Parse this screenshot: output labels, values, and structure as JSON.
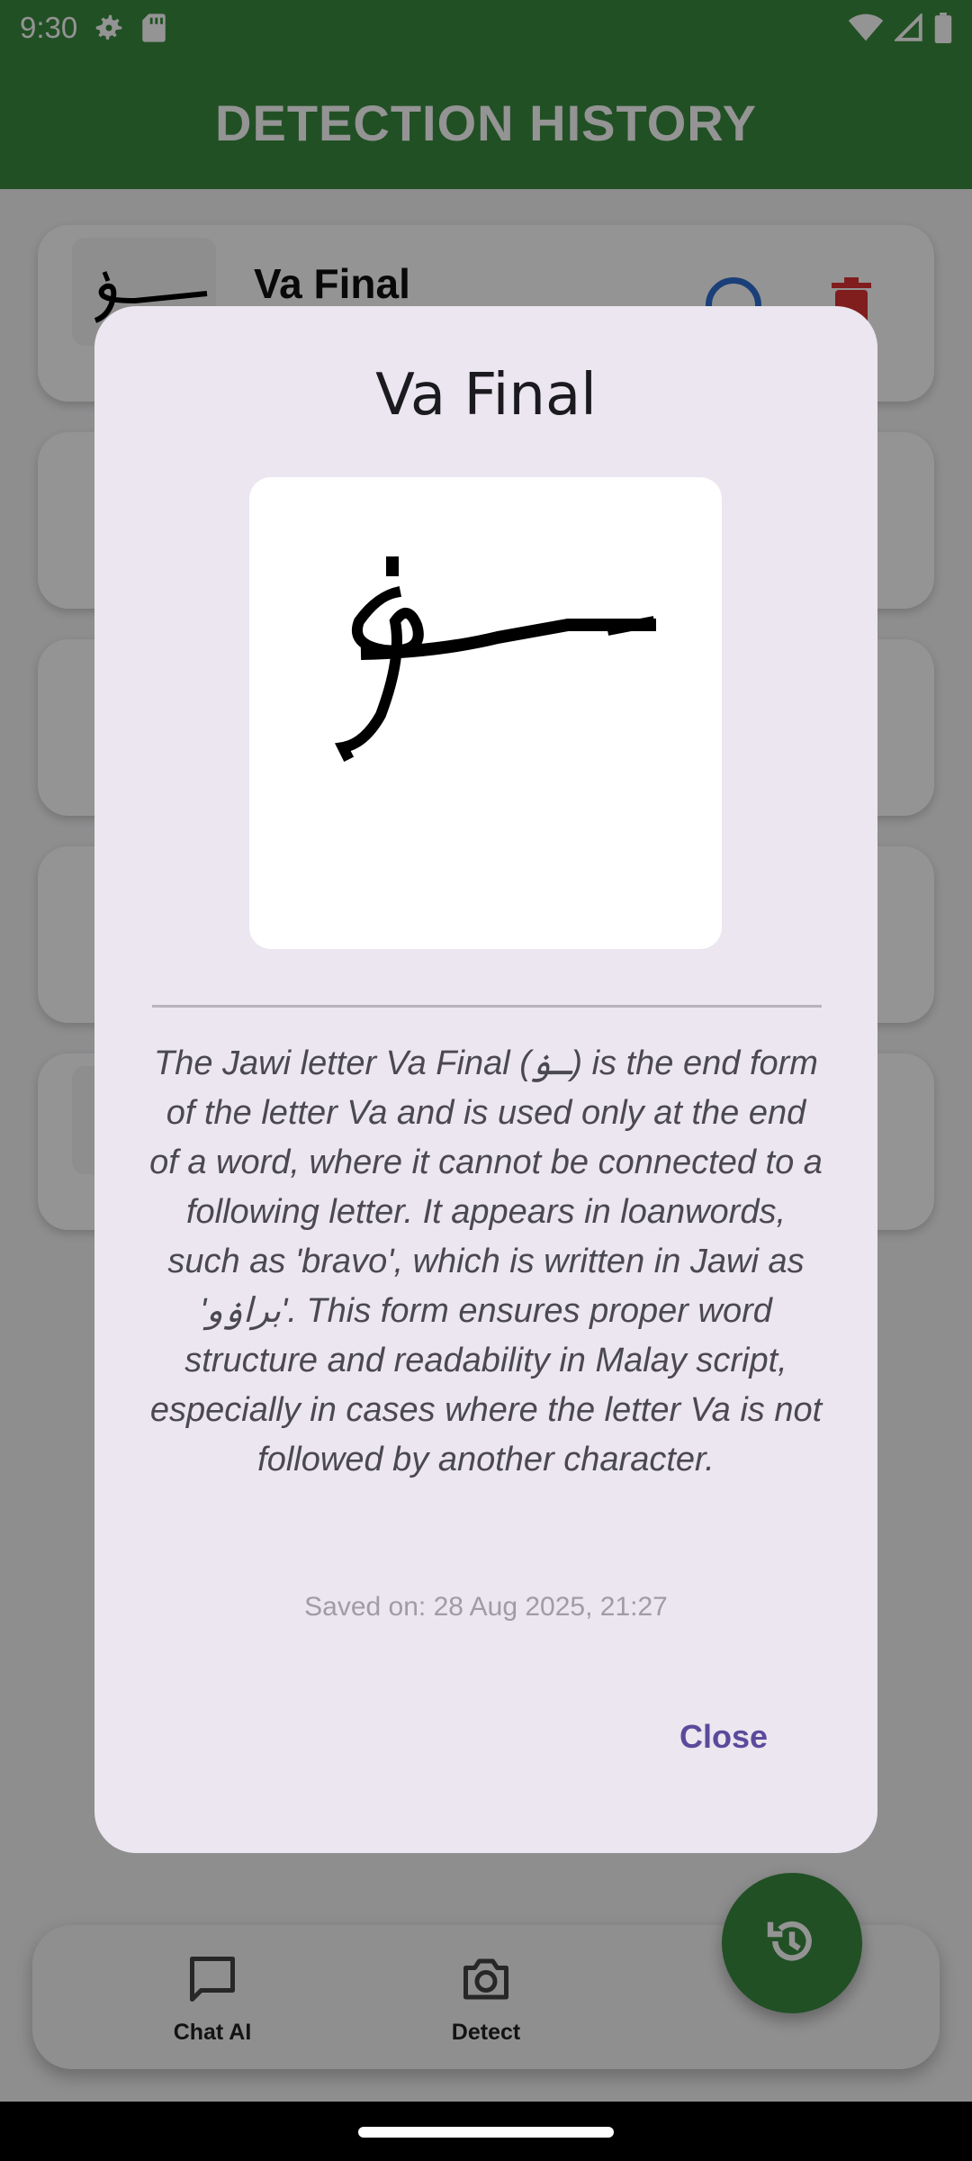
{
  "status_bar": {
    "time": "9:30"
  },
  "app_bar": {
    "title": "DETECTION HISTORY"
  },
  "history": {
    "items": [
      {
        "title": "Va Final"
      }
    ]
  },
  "dialog": {
    "title": "Va Final",
    "description": "The Jawi letter Va Final (ـۏ) is the end form of the letter Va and is used only at the end of a word, where it cannot be connected to a following letter. It appears in loanwords, such as 'bravo', which is written in Jawi as 'براۏو'. This form ensures proper word structure and readability in Malay script, especially in cases where the letter Va is not followed by another character.",
    "saved_on": "Saved on: 28 Aug 2025, 21:27",
    "close_label": "Close"
  },
  "bottom_nav": {
    "items": [
      {
        "label": "Chat AI",
        "icon": "chat-icon"
      },
      {
        "label": "Detect",
        "icon": "camera-icon"
      }
    ],
    "fab_icon": "history-icon"
  },
  "colors": {
    "primary_green": "#3a8a3f",
    "dialog_background": "#ebe6ef",
    "close_button": "#5a4a9c"
  }
}
